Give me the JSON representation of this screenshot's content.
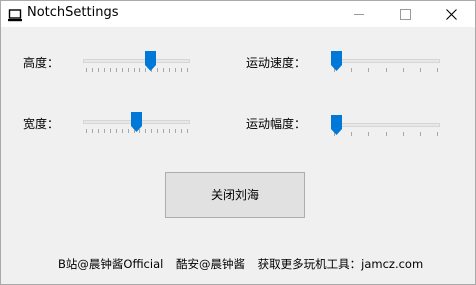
{
  "window": {
    "title": "NotchSettings"
  },
  "controls": {
    "height": {
      "label": "高度：",
      "value": 0.65
    },
    "width": {
      "label": "宽度：",
      "value": 0.5
    },
    "speed": {
      "label": "运动速度：",
      "value": 0.0
    },
    "amplitude": {
      "label": "运动幅度：",
      "value": 0.0
    }
  },
  "close_notch_button": {
    "label": "关闭刘海"
  },
  "footer": {
    "bilibili": "B站@晨钟酱Official",
    "coolapk": "酷安@晨钟酱",
    "more": "获取更多玩机工具：jamcz.com"
  },
  "colors": {
    "accent": "#0078d7",
    "track": "#e7e7e7",
    "background": "#f0f0f0"
  }
}
